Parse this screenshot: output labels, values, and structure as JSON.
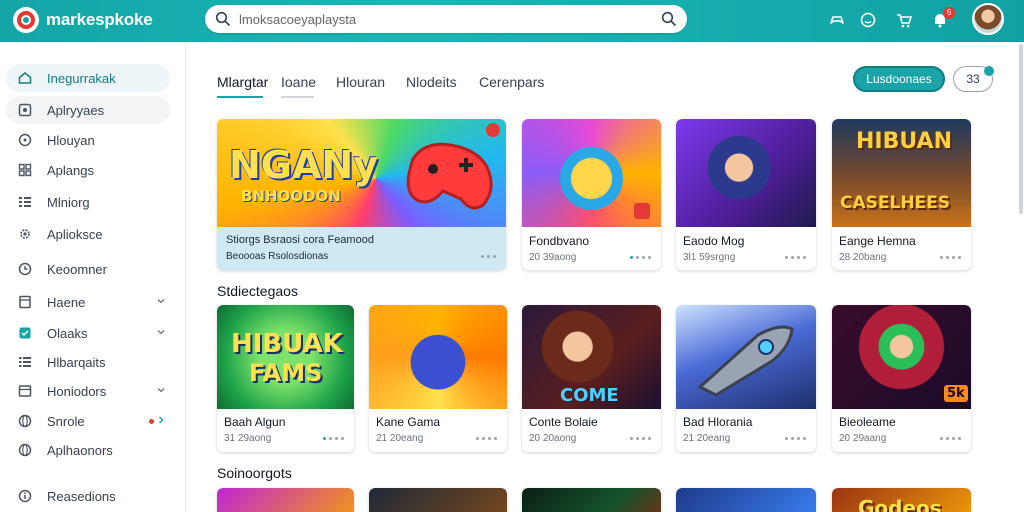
{
  "header": {
    "brand": "markespkoke",
    "search_placeholder": "lmoksacoeyaplaysta",
    "notification_count": "6"
  },
  "sidebar": {
    "items": [
      {
        "label": "Inegurrakak",
        "icon": "home-icon"
      },
      {
        "label": "Aplryyaes",
        "icon": "apps-icon"
      },
      {
        "label": "Hlouyan",
        "icon": "gamepad-icon"
      },
      {
        "label": "Aplangs",
        "icon": "grid-icon"
      },
      {
        "label": "Mlniorg",
        "icon": "list-icon"
      },
      {
        "label": "Aplioksce",
        "icon": "gear-icon"
      },
      {
        "label": "Keoomner",
        "icon": "clock-icon"
      },
      {
        "label": "Haene",
        "icon": "bookmark-icon"
      },
      {
        "label": "Olaaks",
        "icon": "check-icon"
      },
      {
        "label": "Hlbarqaits",
        "icon": "table-icon"
      },
      {
        "label": "Honiodors",
        "icon": "box-icon"
      },
      {
        "label": "Snrole",
        "icon": "globe-icon"
      },
      {
        "label": "Aplhaonors",
        "icon": "globe-icon"
      },
      {
        "label": "Reasedions",
        "icon": "info-icon"
      }
    ]
  },
  "tabs": [
    {
      "label": "Mlargtar"
    },
    {
      "label": "Ioane"
    },
    {
      "label": "Hlouran"
    },
    {
      "label": "Nlodeits"
    },
    {
      "label": "Cerenpars"
    }
  ],
  "actions": {
    "primary_label": "Lusdoonaes",
    "secondary_label": "33"
  },
  "featured": {
    "art_title": "NGANy",
    "art_subtitle": "BNHOODON",
    "line1": "Stiorgs  Bsraosi cora Feamood",
    "line2": "Beoooas   Rsolosdionas"
  },
  "rows": [
    {
      "section": "",
      "cards": [
        {
          "title": "Fondbvano",
          "meta": "20 39aong"
        },
        {
          "title": "Eaodo Mog",
          "meta": "3l1 59srgng"
        },
        {
          "title": "Eange Hemna",
          "meta": "28 20bang",
          "art_text_1": "HIBUAN",
          "art_text_2": "CASELHEES"
        }
      ]
    },
    {
      "section": "Stdiectegaos",
      "cards": [
        {
          "title": "Baah Algun",
          "meta": "31 29aong",
          "art_text_1": "HIBUAK",
          "art_text_2": "FAMS"
        },
        {
          "title": "Kane Gama",
          "meta": "21 20eang"
        },
        {
          "title": "Conte Bolaie",
          "meta": "20 20aong",
          "art_text_1": "COME"
        },
        {
          "title": "Bad Hlorania",
          "meta": "21 20eang"
        },
        {
          "title": "Bieoleame",
          "meta": "20 29aang",
          "art_text_1": "5k"
        }
      ]
    },
    {
      "section": "Soinoorgots",
      "cards": [
        {
          "title": ""
        },
        {
          "title": ""
        },
        {
          "title": ""
        },
        {
          "title": ""
        },
        {
          "title": "",
          "art_text_1": "Godeos"
        }
      ]
    }
  ],
  "colors": {
    "accent": "#13a4a6",
    "accent_dark": "#0f7f84",
    "badge": "#e53935"
  }
}
